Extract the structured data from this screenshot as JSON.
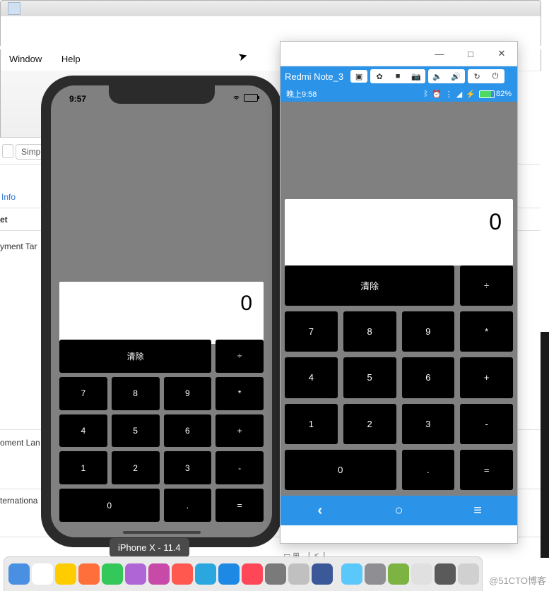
{
  "menu": {
    "window": "Window",
    "help": "Help"
  },
  "xcode": {
    "simp": "Simp",
    "info": "Info",
    "et": "et",
    "yment": "yment Tar",
    "oment": "oment Lan",
    "ternational": "ternationa"
  },
  "iphone": {
    "time": "9:57",
    "tooltip": "iPhone X - 11.4"
  },
  "android": {
    "device": "Redmi Note_3",
    "time": "晚上9:58",
    "battery": "82%",
    "toolbar_icons": [
      "▣",
      "✿",
      "■",
      "📷",
      "🔈",
      "🔊",
      "↻",
      "⏻"
    ]
  },
  "calc": {
    "display": "0",
    "clear": "清除",
    "keys": {
      "div": "÷",
      "mul": "*",
      "add": "+",
      "sub": "-",
      "eq": "=",
      "dot": ".",
      "0": "0",
      "1": "1",
      "2": "2",
      "3": "3",
      "4": "4",
      "5": "5",
      "6": "6",
      "7": "7",
      "8": "8",
      "9": "9"
    }
  },
  "android_nav": {
    "back": "‹",
    "home": "○",
    "menu": "≡"
  },
  "win_controls": {
    "min": "—",
    "max": "□",
    "close": "✕"
  },
  "watermark": "@51CTO博客",
  "dock_colors": [
    "#4a90e2",
    "#fff",
    "#ffcc00",
    "#ff6f3c",
    "#34c759",
    "#b065d6",
    "#c74aa8",
    "#ff594f",
    "#2aa7df",
    "#1e88e5",
    "#ff4757",
    "#7a7a7a",
    "#c0c0c0",
    "#3b5998",
    "#5ac8fa",
    "#8e8e93",
    "#7cb342",
    "#e0e0e0",
    "#5a5a5a",
    "#d0d0d0"
  ]
}
